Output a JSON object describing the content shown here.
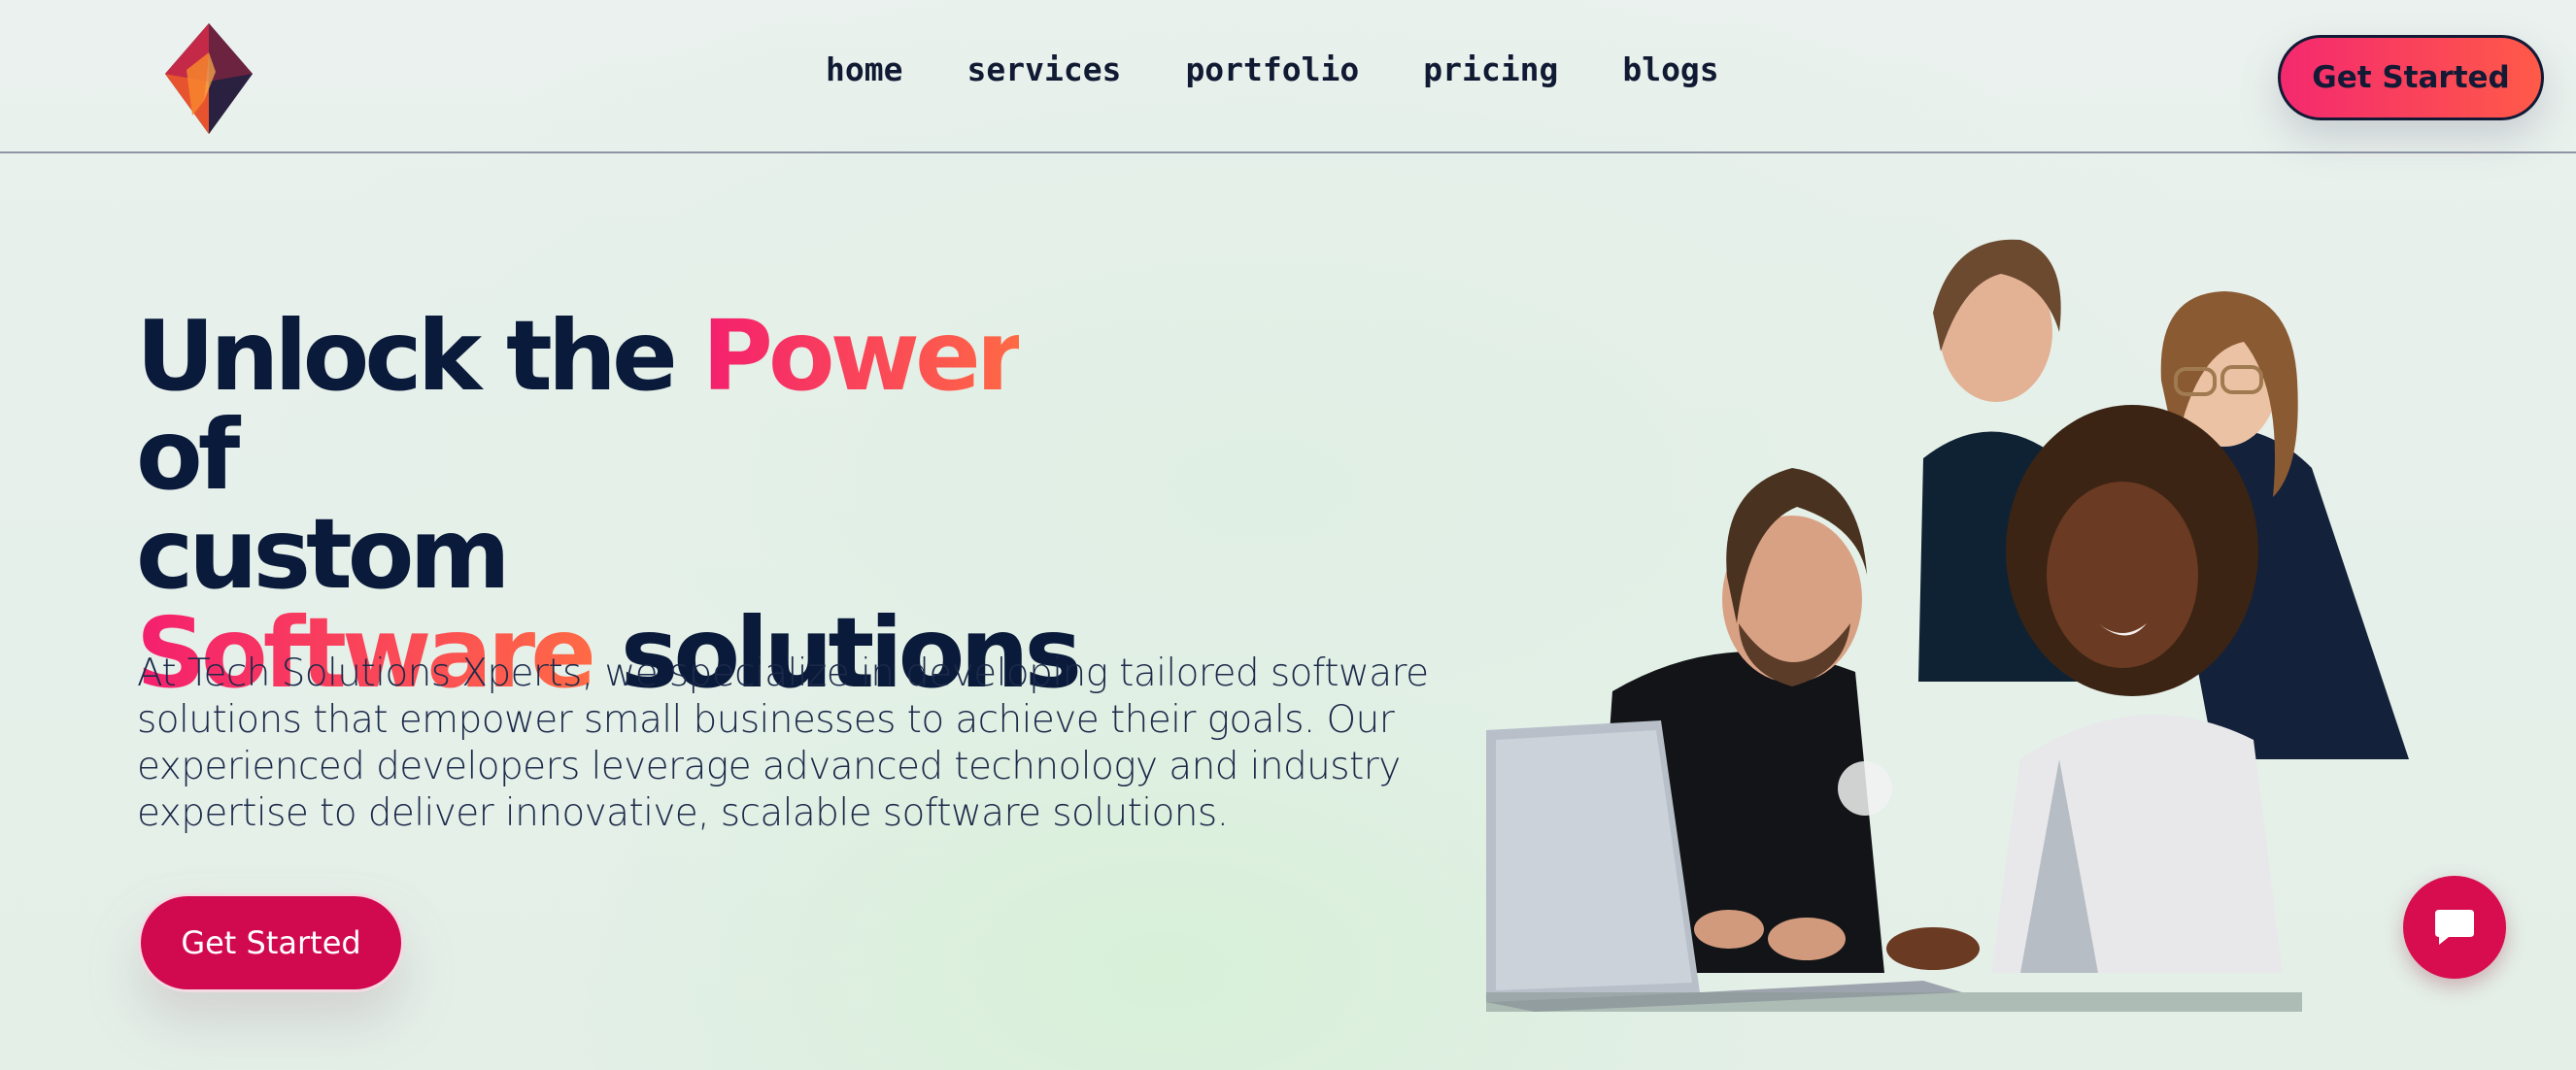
{
  "brand": {
    "logo_icon": "diamond-gem-icon"
  },
  "nav": {
    "items": [
      {
        "label": "home"
      },
      {
        "label": "services"
      },
      {
        "label": "portfolio"
      },
      {
        "label": "pricing"
      },
      {
        "label": "blogs"
      }
    ]
  },
  "header": {
    "cta_label": "Get Started"
  },
  "hero": {
    "headline": {
      "part1": "Unlock the ",
      "highlight1": "Power",
      "part2": " of",
      "line2": "custom",
      "highlight2": "Software",
      "part3": " solutions"
    },
    "description": "At Tech Solutions Xperts, we specialize in developing tailored software solutions that empower small businesses to achieve their goals. Our experienced developers leverage advanced technology and industry expertise to deliver innovative, scalable software solutions.",
    "cta_label": "Get Started",
    "image_icon": "team-at-laptop-illustration"
  },
  "chat": {
    "icon": "chat-bubble-icon"
  },
  "colors": {
    "accent_start": "#f41f6e",
    "accent_end": "#ff6a45",
    "button": "#d10a50",
    "text_dark": "#0a1a3a"
  }
}
